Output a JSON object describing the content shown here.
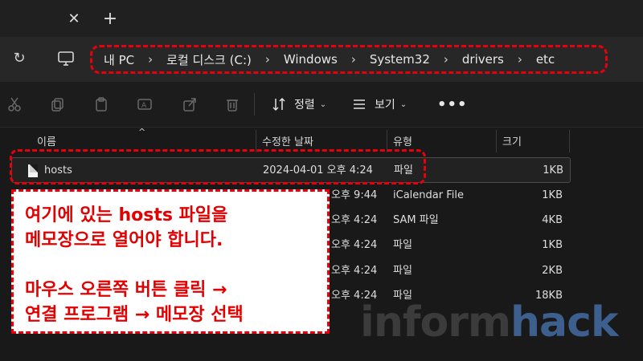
{
  "breadcrumbs": [
    {
      "label": "내 PC"
    },
    {
      "label": "로컬 디스크 (C:)"
    },
    {
      "label": "Windows"
    },
    {
      "label": "System32"
    },
    {
      "label": "drivers"
    },
    {
      "label": "etc"
    }
  ],
  "toolbar": {
    "sort_label": "정렬",
    "view_label": "보기",
    "more_label": "•••"
  },
  "columns": {
    "name": "이름",
    "date": "수정한 날짜",
    "type": "유형",
    "size": "크기"
  },
  "files": [
    {
      "name": "hosts",
      "date": "2024-04-01 오후 4:24",
      "type": "파일",
      "size": "1KB"
    },
    {
      "name": "",
      "date": "오후 9:44",
      "type": "iCalendar File",
      "size": "1KB"
    },
    {
      "name": "",
      "date": "오후 4:24",
      "type": "SAM 파일",
      "size": "4KB"
    },
    {
      "name": "",
      "date": "오후 4:24",
      "type": "파일",
      "size": "1KB"
    },
    {
      "name": "",
      "date": "오후 4:24",
      "type": "파일",
      "size": "2KB"
    },
    {
      "name": "",
      "date": "오후 4:24",
      "type": "파일",
      "size": "18KB"
    }
  ],
  "callout": {
    "line1": "여기에 있는 hosts 파일을",
    "line2": "메모장으로 열어야 합니다.",
    "line3": "마우스 오른쪽 버튼 클릭 →",
    "line4": "연결 프로그램 → 메모장 선택"
  },
  "watermark": {
    "part1": "inform",
    "part2": "hack"
  },
  "colors": {
    "highlight": "#e8000b",
    "callout_text": "#e30000",
    "watermark_accent": "#3d5f8d"
  }
}
